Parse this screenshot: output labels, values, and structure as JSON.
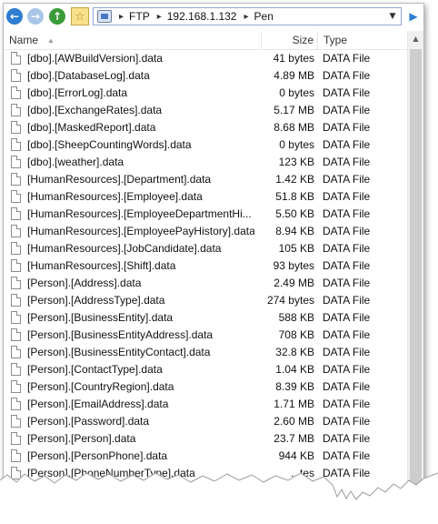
{
  "nav": {
    "back_glyph": "←",
    "forward_glyph": "→",
    "up_glyph": "↑",
    "favorite_glyph": "☆"
  },
  "address": {
    "separator": "▸",
    "crumbs": [
      "FTP",
      "192.168.1.132",
      "Pen"
    ],
    "dropdown_glyph": "▼"
  },
  "side_button_glyph": "▶",
  "columns": {
    "name": "Name",
    "size": "Size",
    "type": "Type",
    "sort_glyph": "▲"
  },
  "files": [
    {
      "name": "[dbo].[AWBuildVersion].data",
      "size": "41 bytes",
      "type": "DATA File"
    },
    {
      "name": "[dbo].[DatabaseLog].data",
      "size": "4.89 MB",
      "type": "DATA File"
    },
    {
      "name": "[dbo].[ErrorLog].data",
      "size": "0 bytes",
      "type": "DATA File"
    },
    {
      "name": "[dbo].[ExchangeRates].data",
      "size": "5.17 MB",
      "type": "DATA File"
    },
    {
      "name": "[dbo].[MaskedReport].data",
      "size": "8.68 MB",
      "type": "DATA File"
    },
    {
      "name": "[dbo].[SheepCountingWords].data",
      "size": "0 bytes",
      "type": "DATA File"
    },
    {
      "name": "[dbo].[weather].data",
      "size": "123 KB",
      "type": "DATA File"
    },
    {
      "name": "[HumanResources].[Department].data",
      "size": "1.42 KB",
      "type": "DATA File"
    },
    {
      "name": "[HumanResources].[Employee].data",
      "size": "51.8 KB",
      "type": "DATA File"
    },
    {
      "name": "[HumanResources].[EmployeeDepartmentHi...",
      "size": "5.50 KB",
      "type": "DATA File"
    },
    {
      "name": "[HumanResources].[EmployeePayHistory].data",
      "size": "8.94 KB",
      "type": "DATA File"
    },
    {
      "name": "[HumanResources].[JobCandidate].data",
      "size": "105 KB",
      "type": "DATA File"
    },
    {
      "name": "[HumanResources].[Shift].data",
      "size": "93 bytes",
      "type": "DATA File"
    },
    {
      "name": "[Person].[Address].data",
      "size": "2.49 MB",
      "type": "DATA File"
    },
    {
      "name": "[Person].[AddressType].data",
      "size": "274 bytes",
      "type": "DATA File"
    },
    {
      "name": "[Person].[BusinessEntity].data",
      "size": "588 KB",
      "type": "DATA File"
    },
    {
      "name": "[Person].[BusinessEntityAddress].data",
      "size": "708 KB",
      "type": "DATA File"
    },
    {
      "name": "[Person].[BusinessEntityContact].data",
      "size": "32.8 KB",
      "type": "DATA File"
    },
    {
      "name": "[Person].[ContactType].data",
      "size": "1.04 KB",
      "type": "DATA File"
    },
    {
      "name": "[Person].[CountryRegion].data",
      "size": "8.39 KB",
      "type": "DATA File"
    },
    {
      "name": "[Person].[EmailAddress].data",
      "size": "1.71 MB",
      "type": "DATA File"
    },
    {
      "name": "[Person].[Password].data",
      "size": "2.60 MB",
      "type": "DATA File"
    },
    {
      "name": "[Person].[Person].data",
      "size": "23.7 MB",
      "type": "DATA File"
    },
    {
      "name": "[Person].[PersonPhone].data",
      "size": "944 KB",
      "type": "DATA File"
    },
    {
      "name": "[Person].[PhoneNumberType].data",
      "size": "...tes",
      "type": "DATA File"
    }
  ]
}
